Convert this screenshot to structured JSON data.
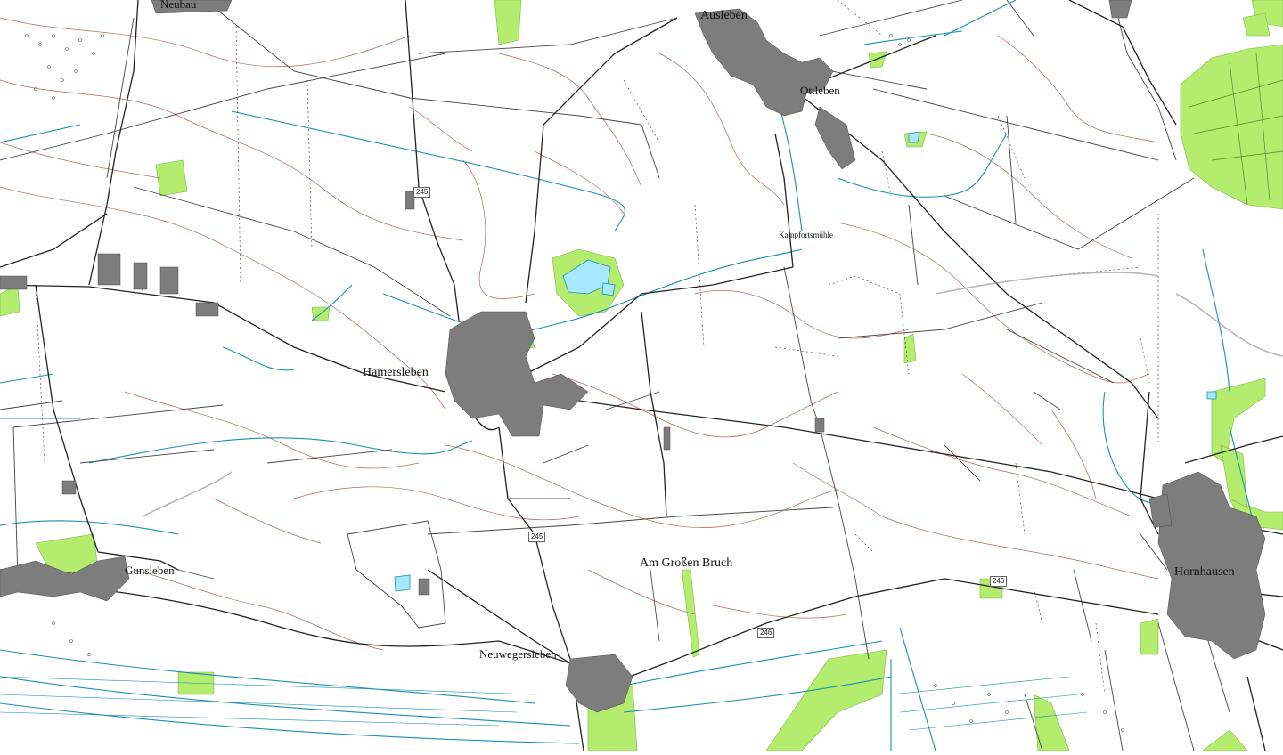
{
  "map": {
    "type": "topographic",
    "colors": {
      "background": "#ffffff",
      "contour": "#a84c3c",
      "water": "#1a8fb0",
      "forest": "#b4ec6e",
      "settlement": "#7d7d7d",
      "road": "#222222",
      "track": "#555555"
    }
  },
  "places": {
    "neubau": "Neubau",
    "ausleben": "Ausleben",
    "ottleben": "Ottleben",
    "kampfortsmuehle": "Kampfortsmühle",
    "hamersleben": "Hamersleben",
    "gunsleben": "Gunsleben",
    "neuwegersleben": "Neuwegersleben",
    "hornhausen": "Hornhausen",
    "am_grossen_bruch": "Am Großen Bruch"
  },
  "roads": {
    "b245_a": "245",
    "b245_b": "245",
    "b246_a": "246",
    "b246_b": "246"
  }
}
